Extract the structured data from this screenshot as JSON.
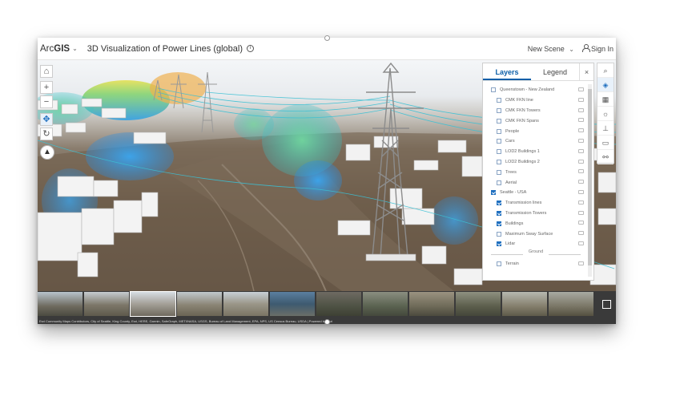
{
  "header": {
    "brand_prefix": "Arc",
    "brand_bold": "GIS",
    "title": "3D Visualization of Power Lines (global)",
    "new_scene": "New Scene",
    "sign_in": "Sign In",
    "caret": "⌄"
  },
  "nav_controls": [
    "home-icon",
    "zoom-in-icon",
    "zoom-out-icon",
    "pan-icon",
    "rotate-icon",
    "compass-icon"
  ],
  "panel": {
    "tab_layers": "Layers",
    "tab_legend": "Legend",
    "close": "×",
    "groups": [
      {
        "name": "Queenstown - New Zealand",
        "checked": false,
        "layers": [
          {
            "name": "CMK FKN line",
            "checked": false
          },
          {
            "name": "CMK FKN Towers",
            "checked": false
          },
          {
            "name": "CMK FKN Spans",
            "checked": false
          },
          {
            "name": "People",
            "checked": false
          },
          {
            "name": "Cars",
            "checked": false
          },
          {
            "name": "LOD2 Buildings 1",
            "checked": false
          },
          {
            "name": "LOD2 Buildings 2",
            "checked": false
          },
          {
            "name": "Trees",
            "checked": false
          },
          {
            "name": "Aerial",
            "checked": false
          }
        ]
      },
      {
        "name": "Seattle - USA",
        "checked": true,
        "layers": [
          {
            "name": "Transmission lines",
            "checked": true
          },
          {
            "name": "Transmission Towers",
            "checked": true
          },
          {
            "name": "Buildings",
            "checked": true
          },
          {
            "name": "Maximum Sway Surface",
            "checked": false
          },
          {
            "name": "Lidar",
            "checked": true
          }
        ]
      }
    ],
    "ground_label": "Ground",
    "ground_layers": [
      {
        "name": "Terrain",
        "checked": false
      }
    ]
  },
  "toolbar": [
    "search-icon",
    "layers-icon",
    "basemap-icon",
    "daylight-icon",
    "measure-icon",
    "slides-icon",
    "share-icon"
  ],
  "thumbnails": 12,
  "attribution": "Esri Community Maps Contributors, City of Seattle, King County, Esri, HERE, Garmin, SafeGraph, METI/NASA, USGS, Bureau of Land Management, EPA, NPS, US Census Bureau, USDA | Powered by Esri"
}
